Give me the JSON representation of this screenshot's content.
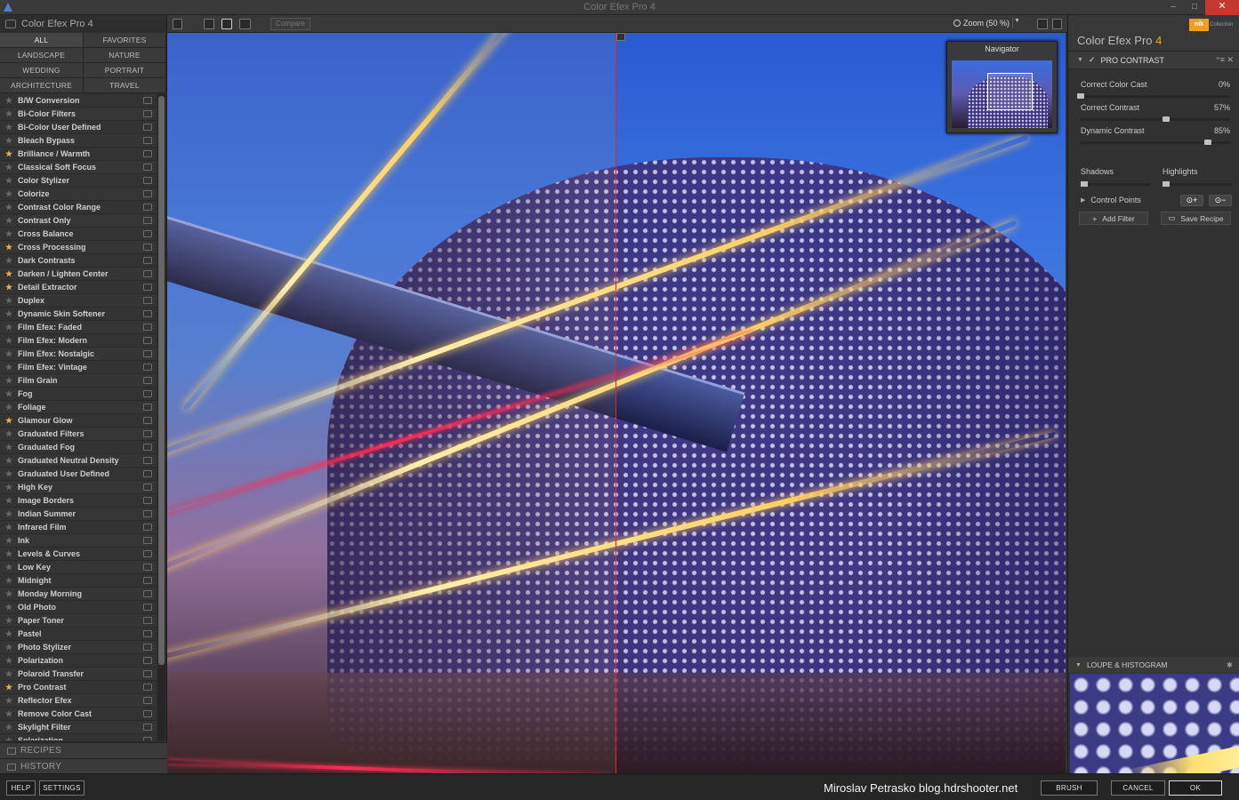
{
  "window": {
    "title": "Color Efex Pro 4",
    "minimize": "–",
    "maximize": "□",
    "close": "✕"
  },
  "left_panel": {
    "title": "Color Efex Pro 4",
    "categories": [
      "ALL",
      "FAVORITES",
      "LANDSCAPE",
      "NATURE",
      "WEDDING",
      "PORTRAIT",
      "ARCHITECTURE",
      "TRAVEL"
    ],
    "filters": [
      {
        "label": "B/W Conversion",
        "fav": false
      },
      {
        "label": "Bi-Color Filters",
        "fav": false
      },
      {
        "label": "Bi-Color User Defined",
        "fav": false
      },
      {
        "label": "Bleach Bypass",
        "fav": false
      },
      {
        "label": "Brilliance / Warmth",
        "fav": true
      },
      {
        "label": "Classical Soft Focus",
        "fav": false
      },
      {
        "label": "Color Stylizer",
        "fav": false
      },
      {
        "label": "Colorize",
        "fav": false
      },
      {
        "label": "Contrast Color Range",
        "fav": false
      },
      {
        "label": "Contrast Only",
        "fav": false
      },
      {
        "label": "Cross Balance",
        "fav": false
      },
      {
        "label": "Cross Processing",
        "fav": true
      },
      {
        "label": "Dark Contrasts",
        "fav": false
      },
      {
        "label": "Darken / Lighten Center",
        "fav": true
      },
      {
        "label": "Detail Extractor",
        "fav": true
      },
      {
        "label": "Duplex",
        "fav": false
      },
      {
        "label": "Dynamic Skin Softener",
        "fav": false
      },
      {
        "label": "Film Efex: Faded",
        "fav": false
      },
      {
        "label": "Film Efex: Modern",
        "fav": false
      },
      {
        "label": "Film Efex: Nostalgic",
        "fav": false
      },
      {
        "label": "Film Efex: Vintage",
        "fav": false
      },
      {
        "label": "Film Grain",
        "fav": false
      },
      {
        "label": "Fog",
        "fav": false
      },
      {
        "label": "Foliage",
        "fav": false
      },
      {
        "label": "Glamour Glow",
        "fav": true
      },
      {
        "label": "Graduated Filters",
        "fav": false
      },
      {
        "label": "Graduated Fog",
        "fav": false
      },
      {
        "label": "Graduated Neutral Density",
        "fav": false
      },
      {
        "label": "Graduated User Defined",
        "fav": false
      },
      {
        "label": "High Key",
        "fav": false
      },
      {
        "label": "Image Borders",
        "fav": false
      },
      {
        "label": "Indian Summer",
        "fav": false
      },
      {
        "label": "Infrared Film",
        "fav": false
      },
      {
        "label": "Ink",
        "fav": false
      },
      {
        "label": "Levels & Curves",
        "fav": false
      },
      {
        "label": "Low Key",
        "fav": false
      },
      {
        "label": "Midnight",
        "fav": false
      },
      {
        "label": "Monday Morning",
        "fav": false
      },
      {
        "label": "Old Photo",
        "fav": false
      },
      {
        "label": "Paper Toner",
        "fav": false
      },
      {
        "label": "Pastel",
        "fav": false
      },
      {
        "label": "Photo Stylizer",
        "fav": false
      },
      {
        "label": "Polarization",
        "fav": false
      },
      {
        "label": "Polaroid Transfer",
        "fav": false
      },
      {
        "label": "Pro Contrast",
        "fav": true
      },
      {
        "label": "Reflector Efex",
        "fav": false
      },
      {
        "label": "Remove Color Cast",
        "fav": false
      },
      {
        "label": "Skylight Filter",
        "fav": false
      },
      {
        "label": "Solarization",
        "fav": false
      }
    ],
    "recipes_label": "RECIPES",
    "history_label": "HISTORY"
  },
  "toolbar": {
    "compare_label": "Compare",
    "zoom_label": "Zoom (50 %)",
    "zoom_dropdown": "▼"
  },
  "navigator": {
    "title": "Navigator"
  },
  "right_panel": {
    "brand_name": "Color Efex Pro ",
    "brand_version": "4",
    "nik_label": "nik",
    "collection_label": "Collection",
    "filter_title": "PRO CONTRAST",
    "filter_check": "✓",
    "filter_controls": "⁼≡ ✕",
    "sliders": [
      {
        "label": "Correct Color Cast",
        "value": "0%",
        "fraction": 0.0
      },
      {
        "label": "Correct Contrast",
        "value": "57%",
        "fraction": 0.57
      },
      {
        "label": "Dynamic Contrast",
        "value": "85%",
        "fraction": 0.85
      }
    ],
    "shadows_label": "Shadows",
    "highlights_label": "Highlights",
    "control_points_label": "Control Points",
    "cp_add": "⊙+",
    "cp_remove": "⊙−",
    "add_filter_label": "Add Filter",
    "save_recipe_label": "Save Recipe",
    "loupe_label": "LOUPE & HISTOGRAM"
  },
  "bottom_bar": {
    "help_label": "HELP",
    "settings_label": "SETTINGS",
    "credit": "Miroslav  Petrasko  blog.hdrshooter.net",
    "brush_label": "BRUSH",
    "cancel_label": "CANCEL",
    "ok_label": "OK"
  }
}
